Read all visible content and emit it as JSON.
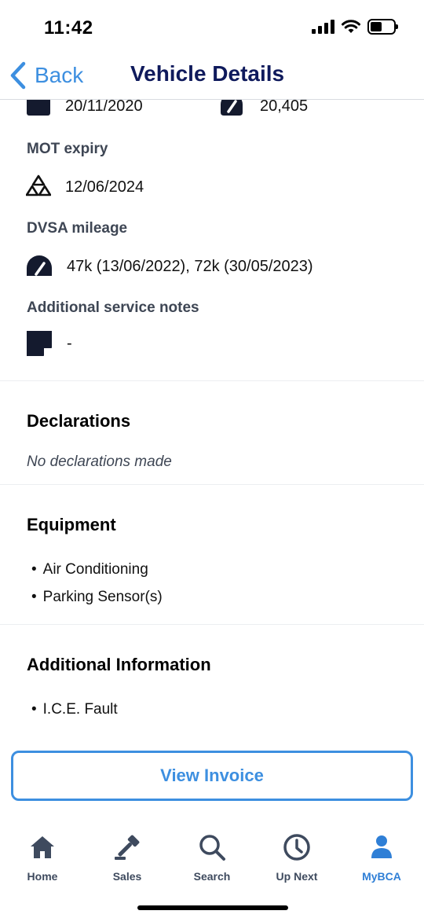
{
  "status_bar": {
    "time": "11:42"
  },
  "nav": {
    "back_label": "Back",
    "title": "Vehicle Details"
  },
  "details": {
    "reg_date": "20/11/2020",
    "mileage": "20,405",
    "mot_label": "MOT expiry",
    "mot_value": "12/06/2024",
    "dvsa_label": "DVSA mileage",
    "dvsa_value": "47k (13/06/2022), 72k (30/05/2023)",
    "notes_label": "Additional service notes",
    "notes_value": "-"
  },
  "declarations": {
    "title": "Declarations",
    "note": "No declarations made"
  },
  "equipment": {
    "title": "Equipment",
    "items": [
      "Air Conditioning",
      "Parking Sensor(s)"
    ]
  },
  "additional_info": {
    "title": "Additional Information",
    "items": [
      "I.C.E. Fault"
    ]
  },
  "invoice_button": "View Invoice",
  "tabs": [
    {
      "label": "Home",
      "icon": "home-icon"
    },
    {
      "label": "Sales",
      "icon": "gavel-icon"
    },
    {
      "label": "Search",
      "icon": "search-icon"
    },
    {
      "label": "Up Next",
      "icon": "clock-icon"
    },
    {
      "label": "MyBCA",
      "icon": "person-icon",
      "active": true
    }
  ],
  "colors": {
    "accent": "#3d8fe0",
    "title": "#0f1a5c",
    "tab_active": "#2f7fd6",
    "tab_inactive": "#3e4a5e"
  }
}
